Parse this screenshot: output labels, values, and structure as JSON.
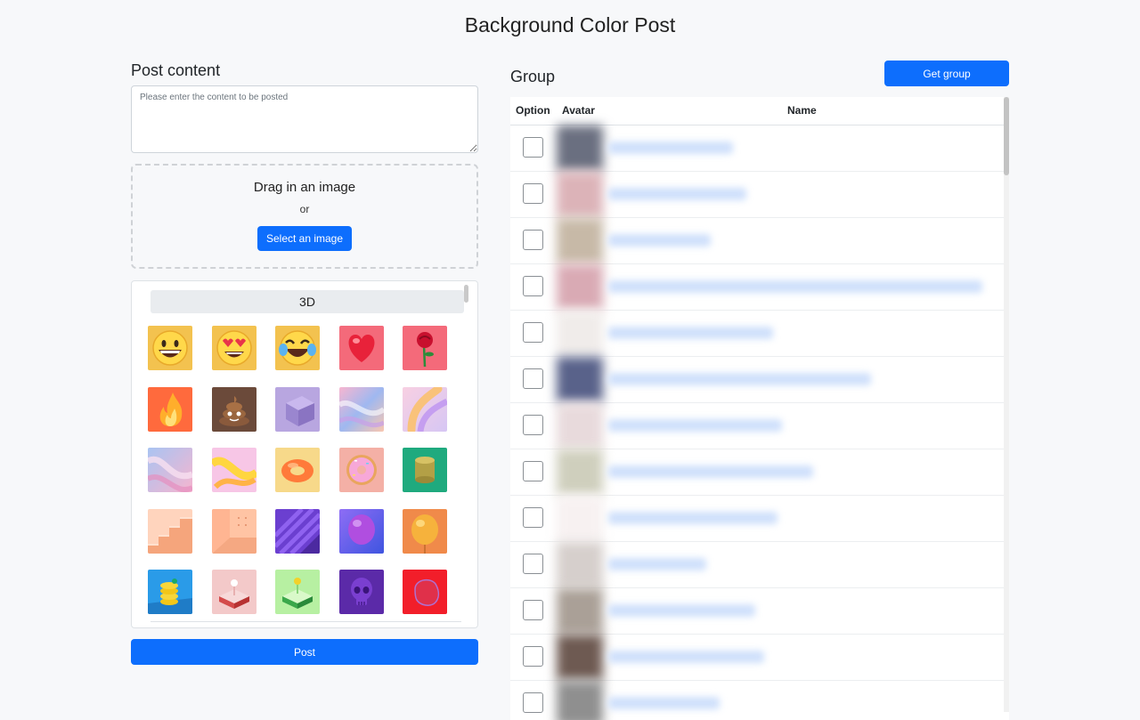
{
  "page": {
    "title": "Background Color Post"
  },
  "post": {
    "heading": "Post content",
    "placeholder": "Please enter the content to be posted",
    "value": ""
  },
  "dropzone": {
    "title": "Drag in an image",
    "or": "or",
    "button": "Select an image"
  },
  "emoji_panel": {
    "category": "3D",
    "items": [
      {
        "icon": "grinning-face-icon"
      },
      {
        "icon": "heart-eyes-face-icon"
      },
      {
        "icon": "tears-of-joy-face-icon"
      },
      {
        "icon": "red-heart-icon"
      },
      {
        "icon": "rose-icon"
      },
      {
        "icon": "fire-icon"
      },
      {
        "icon": "pile-of-poo-icon"
      },
      {
        "icon": "purple-cube-icon"
      },
      {
        "icon": "pastel-swirl-icon"
      },
      {
        "icon": "pastel-tube-icon"
      },
      {
        "icon": "pastel-wave-icon"
      },
      {
        "icon": "yellow-ribbon-icon"
      },
      {
        "icon": "orange-torus-icon"
      },
      {
        "icon": "donut-icon"
      },
      {
        "icon": "gold-cylinder-icon"
      },
      {
        "icon": "peach-stairs-icon"
      },
      {
        "icon": "peach-room-icon"
      },
      {
        "icon": "purple-stripes-icon"
      },
      {
        "icon": "purple-balloon-icon"
      },
      {
        "icon": "orange-balloon-icon"
      },
      {
        "icon": "yellow-spring-icon"
      },
      {
        "icon": "pink-platform-icon"
      },
      {
        "icon": "green-platform-icon"
      },
      {
        "icon": "purple-skull-icon"
      },
      {
        "icon": "red-blob-icon"
      }
    ]
  },
  "post_button": "Post",
  "group": {
    "heading": "Group",
    "get_button": "Get group",
    "columns": {
      "option": "Option",
      "avatar": "Avatar",
      "name": "Name"
    },
    "rows": [
      {
        "checked": false,
        "avatar_color": "#6a6f80"
      },
      {
        "checked": false,
        "avatar_color": "#dcb3b8"
      },
      {
        "checked": false,
        "avatar_color": "#c7b9a7"
      },
      {
        "checked": false,
        "avatar_color": "#d9aab4"
      },
      {
        "checked": false,
        "avatar_color": "#f0ecea"
      },
      {
        "checked": false,
        "avatar_color": "#59628a"
      },
      {
        "checked": false,
        "avatar_color": "#e8dadc"
      },
      {
        "checked": false,
        "avatar_color": "#cfcfbd"
      },
      {
        "checked": false,
        "avatar_color": "#f7f1f1"
      },
      {
        "checked": false,
        "avatar_color": "#d6cfcc"
      },
      {
        "checked": false,
        "avatar_color": "#aaa097"
      },
      {
        "checked": false,
        "avatar_color": "#6e5a52"
      },
      {
        "checked": false,
        "avatar_color": "#8f8f8f"
      }
    ]
  },
  "colors": {
    "primary": "#0d6efd",
    "background": "#f7f8fa"
  }
}
